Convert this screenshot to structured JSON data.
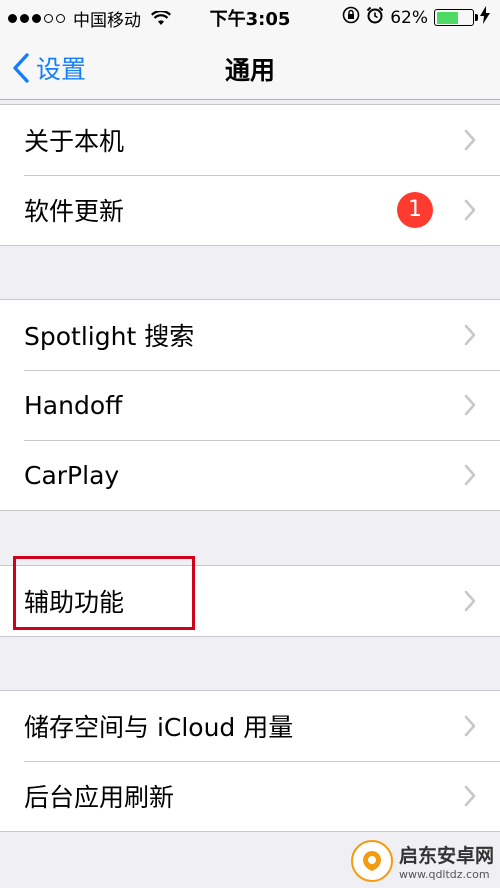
{
  "status_bar": {
    "signal_bars_filled": 3,
    "signal_bars_total": 5,
    "carrier": "中国移动",
    "time": "下午3:05",
    "battery_percent": "62%",
    "battery_level": 0.62,
    "battery_color": "#4cd964"
  },
  "nav": {
    "back_label": "设置",
    "title": "通用",
    "accent_color": "#157efb"
  },
  "groups": [
    {
      "items": [
        {
          "label": "关于本机"
        },
        {
          "label": "软件更新",
          "badge": "1"
        }
      ]
    },
    {
      "items": [
        {
          "label": "Spotlight 搜索"
        },
        {
          "label": "Handoff"
        },
        {
          "label": "CarPlay"
        }
      ]
    },
    {
      "items": [
        {
          "label": "辅助功能",
          "highlighted": true
        }
      ]
    },
    {
      "items": [
        {
          "label": "储存空间与 iCloud 用量"
        },
        {
          "label": "后台应用刷新"
        }
      ]
    }
  ],
  "watermark": {
    "name": "启东安卓网",
    "url": "www.qdltdz.com"
  }
}
